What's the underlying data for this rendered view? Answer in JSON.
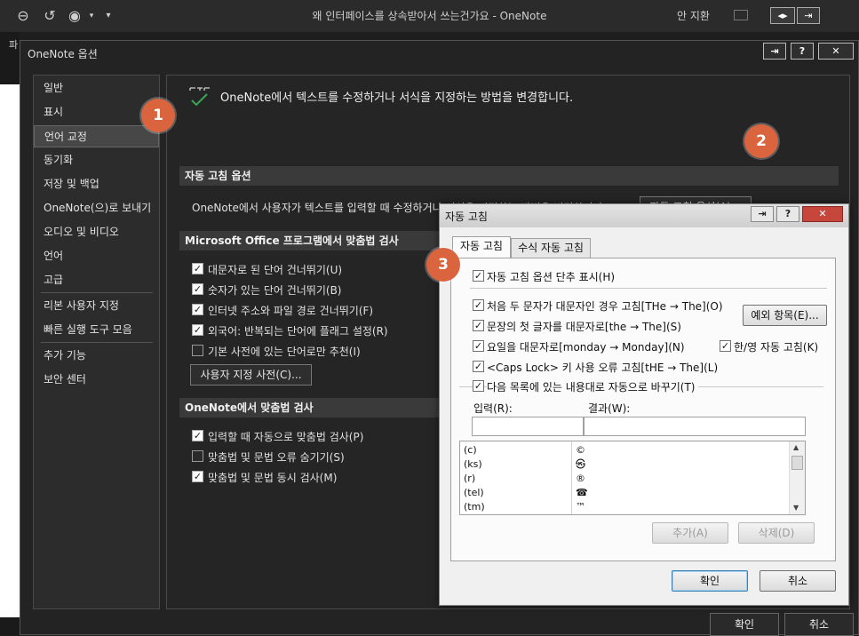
{
  "app": {
    "title": "왜 인터페이스를 상속받아서 쓰는건가요  -  OneNote",
    "user": "안 지환",
    "bg_label": "파"
  },
  "options": {
    "title": "OneNote 옵션",
    "nav": [
      {
        "label": "일반"
      },
      {
        "label": "표시"
      },
      {
        "label": "언어 교정"
      },
      {
        "label": "동기화"
      },
      {
        "label": "저장 및 백업"
      },
      {
        "label": "OneNote(으)로 보내기"
      },
      {
        "label": "오디오 및 비디오"
      },
      {
        "label": "언어"
      },
      {
        "label": "고급"
      },
      {
        "label": "리본 사용자 지정"
      },
      {
        "label": "빠른 실행 도구 모음"
      },
      {
        "label": "추가 기능"
      },
      {
        "label": "보안 센터"
      }
    ],
    "header": "OneNote에서 텍스트를 수정하거나 서식을 지정하는 방법을 변경합니다.",
    "autocorrect_section": "자동 고침 옵션",
    "autocorrect_desc": "OneNote에서 사용자가 텍스트를 입력할 때 수정하거나 서식을 지정하는 방법을 변경합니다.",
    "autocorrect_button": "자동 고침 옵션(A)...",
    "office_section": "Microsoft Office 프로그램에서 맞춤법 검사",
    "office_items": [
      {
        "label": "대문자로 된 단어 건너뛰기(U)",
        "checked": true
      },
      {
        "label": "숫자가 있는 단어 건너뛰기(B)",
        "checked": true
      },
      {
        "label": "인터넷 주소와 파일 경로 건너뛰기(F)",
        "checked": true
      },
      {
        "label": "외국어: 반복되는 단어에 플래그 설정(R)",
        "checked": true
      },
      {
        "label": "기본 사전에 있는 단어로만 추천(I)",
        "checked": false
      }
    ],
    "custom_dict_button": "사용자 지정 사전(C)...",
    "onenote_section": "OneNote에서 맞춤법 검사",
    "onenote_items": [
      {
        "label": "입력할 때 자동으로 맞춤법 검사(P)",
        "checked": true
      },
      {
        "label": "맞춤법 및 문법 오류 숨기기(S)",
        "checked": false
      },
      {
        "label": "맞춤법 및 문법 동시 검사(M)",
        "checked": true
      }
    ],
    "ok": "확인",
    "cancel": "취소",
    "callouts": [
      "1",
      "2",
      "3"
    ]
  },
  "autocorrect": {
    "title": "자동 고침",
    "tabs": [
      "자동 고침",
      "수식 자동 고침"
    ],
    "show_buttons": "자동 고침 옵션 단추 표시(H)",
    "two_initial": "처음 두 문자가 대문자인 경우 고침[THe → The](O)",
    "first_letter": "문장의 첫 글자를 대문자로[the → The](S)",
    "days": "요일을 대문자로[monday → Monday](N)",
    "han_eng": "한/영 자동 고침(K)",
    "caps_lock": "<Caps Lock> 키 사용 오류 고침[tHE → The](L)",
    "replace_text": "다음 목록에 있는 내용대로 자동으로 바꾸기(T)",
    "exceptions_button": "예외 항목(E)...",
    "input_label": "입력(R):",
    "result_label": "결과(W):",
    "list": [
      {
        "key": "(c)",
        "value": "©"
      },
      {
        "key": "(ks)",
        "value": "㉿"
      },
      {
        "key": "(r)",
        "value": "®"
      },
      {
        "key": "(tel)",
        "value": "☎"
      },
      {
        "key": "(tm)",
        "value": "™"
      }
    ],
    "add_button": "추가(A)",
    "delete_button": "삭제(D)",
    "ok": "확인",
    "cancel": "취소"
  }
}
